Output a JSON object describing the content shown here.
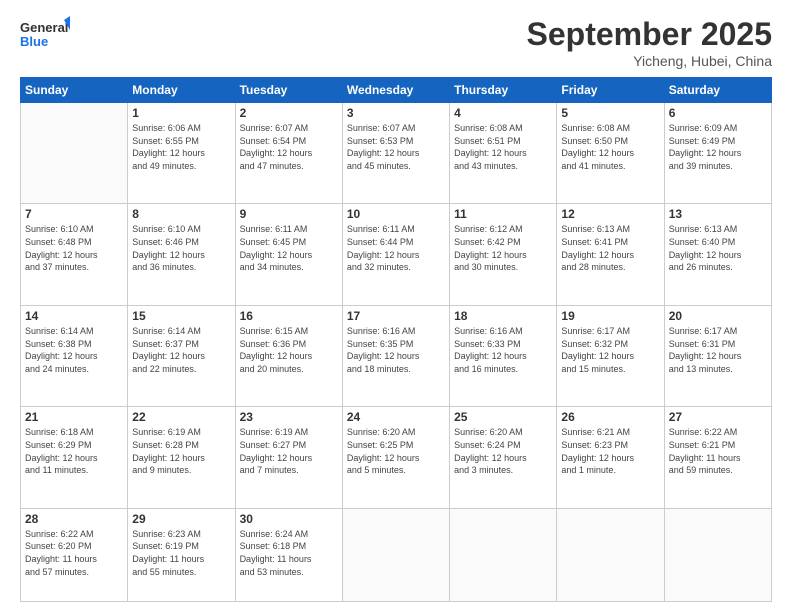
{
  "header": {
    "logo_line1": "General",
    "logo_line2": "Blue",
    "title": "September 2025",
    "location": "Yicheng, Hubei, China"
  },
  "weekdays": [
    "Sunday",
    "Monday",
    "Tuesday",
    "Wednesday",
    "Thursday",
    "Friday",
    "Saturday"
  ],
  "weeks": [
    [
      {
        "day": "",
        "info": ""
      },
      {
        "day": "1",
        "info": "Sunrise: 6:06 AM\nSunset: 6:55 PM\nDaylight: 12 hours\nand 49 minutes."
      },
      {
        "day": "2",
        "info": "Sunrise: 6:07 AM\nSunset: 6:54 PM\nDaylight: 12 hours\nand 47 minutes."
      },
      {
        "day": "3",
        "info": "Sunrise: 6:07 AM\nSunset: 6:53 PM\nDaylight: 12 hours\nand 45 minutes."
      },
      {
        "day": "4",
        "info": "Sunrise: 6:08 AM\nSunset: 6:51 PM\nDaylight: 12 hours\nand 43 minutes."
      },
      {
        "day": "5",
        "info": "Sunrise: 6:08 AM\nSunset: 6:50 PM\nDaylight: 12 hours\nand 41 minutes."
      },
      {
        "day": "6",
        "info": "Sunrise: 6:09 AM\nSunset: 6:49 PM\nDaylight: 12 hours\nand 39 minutes."
      }
    ],
    [
      {
        "day": "7",
        "info": "Sunrise: 6:10 AM\nSunset: 6:48 PM\nDaylight: 12 hours\nand 37 minutes."
      },
      {
        "day": "8",
        "info": "Sunrise: 6:10 AM\nSunset: 6:46 PM\nDaylight: 12 hours\nand 36 minutes."
      },
      {
        "day": "9",
        "info": "Sunrise: 6:11 AM\nSunset: 6:45 PM\nDaylight: 12 hours\nand 34 minutes."
      },
      {
        "day": "10",
        "info": "Sunrise: 6:11 AM\nSunset: 6:44 PM\nDaylight: 12 hours\nand 32 minutes."
      },
      {
        "day": "11",
        "info": "Sunrise: 6:12 AM\nSunset: 6:42 PM\nDaylight: 12 hours\nand 30 minutes."
      },
      {
        "day": "12",
        "info": "Sunrise: 6:13 AM\nSunset: 6:41 PM\nDaylight: 12 hours\nand 28 minutes."
      },
      {
        "day": "13",
        "info": "Sunrise: 6:13 AM\nSunset: 6:40 PM\nDaylight: 12 hours\nand 26 minutes."
      }
    ],
    [
      {
        "day": "14",
        "info": "Sunrise: 6:14 AM\nSunset: 6:38 PM\nDaylight: 12 hours\nand 24 minutes."
      },
      {
        "day": "15",
        "info": "Sunrise: 6:14 AM\nSunset: 6:37 PM\nDaylight: 12 hours\nand 22 minutes."
      },
      {
        "day": "16",
        "info": "Sunrise: 6:15 AM\nSunset: 6:36 PM\nDaylight: 12 hours\nand 20 minutes."
      },
      {
        "day": "17",
        "info": "Sunrise: 6:16 AM\nSunset: 6:35 PM\nDaylight: 12 hours\nand 18 minutes."
      },
      {
        "day": "18",
        "info": "Sunrise: 6:16 AM\nSunset: 6:33 PM\nDaylight: 12 hours\nand 16 minutes."
      },
      {
        "day": "19",
        "info": "Sunrise: 6:17 AM\nSunset: 6:32 PM\nDaylight: 12 hours\nand 15 minutes."
      },
      {
        "day": "20",
        "info": "Sunrise: 6:17 AM\nSunset: 6:31 PM\nDaylight: 12 hours\nand 13 minutes."
      }
    ],
    [
      {
        "day": "21",
        "info": "Sunrise: 6:18 AM\nSunset: 6:29 PM\nDaylight: 12 hours\nand 11 minutes."
      },
      {
        "day": "22",
        "info": "Sunrise: 6:19 AM\nSunset: 6:28 PM\nDaylight: 12 hours\nand 9 minutes."
      },
      {
        "day": "23",
        "info": "Sunrise: 6:19 AM\nSunset: 6:27 PM\nDaylight: 12 hours\nand 7 minutes."
      },
      {
        "day": "24",
        "info": "Sunrise: 6:20 AM\nSunset: 6:25 PM\nDaylight: 12 hours\nand 5 minutes."
      },
      {
        "day": "25",
        "info": "Sunrise: 6:20 AM\nSunset: 6:24 PM\nDaylight: 12 hours\nand 3 minutes."
      },
      {
        "day": "26",
        "info": "Sunrise: 6:21 AM\nSunset: 6:23 PM\nDaylight: 12 hours\nand 1 minute."
      },
      {
        "day": "27",
        "info": "Sunrise: 6:22 AM\nSunset: 6:21 PM\nDaylight: 11 hours\nand 59 minutes."
      }
    ],
    [
      {
        "day": "28",
        "info": "Sunrise: 6:22 AM\nSunset: 6:20 PM\nDaylight: 11 hours\nand 57 minutes."
      },
      {
        "day": "29",
        "info": "Sunrise: 6:23 AM\nSunset: 6:19 PM\nDaylight: 11 hours\nand 55 minutes."
      },
      {
        "day": "30",
        "info": "Sunrise: 6:24 AM\nSunset: 6:18 PM\nDaylight: 11 hours\nand 53 minutes."
      },
      {
        "day": "",
        "info": ""
      },
      {
        "day": "",
        "info": ""
      },
      {
        "day": "",
        "info": ""
      },
      {
        "day": "",
        "info": ""
      }
    ]
  ]
}
